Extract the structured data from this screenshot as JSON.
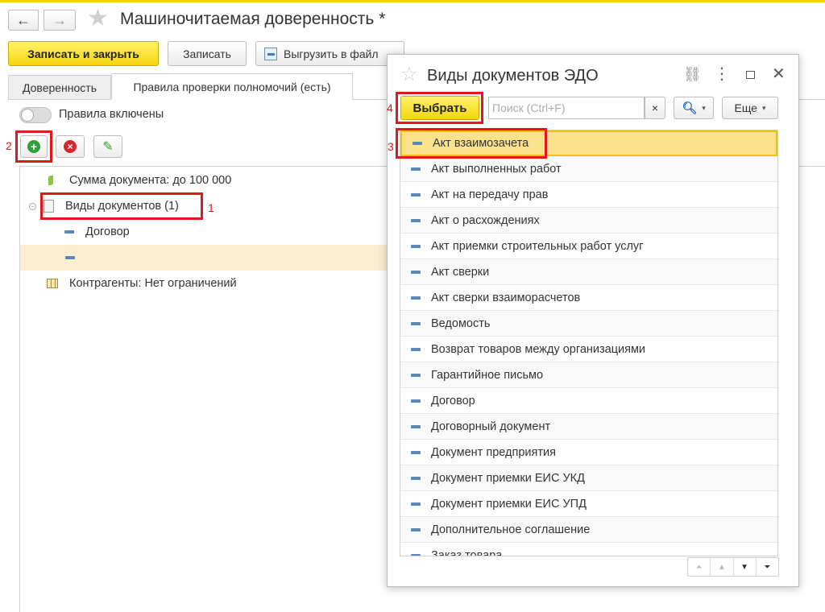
{
  "window": {
    "title": "Машиночитаемая доверенность *"
  },
  "toolbar": {
    "save_close": "Записать и закрыть",
    "save": "Записать",
    "export": "Выгрузить в файл"
  },
  "tabs": [
    {
      "label": "Доверенность"
    },
    {
      "label": "Правила проверки полномочий (есть)"
    }
  ],
  "toggle": {
    "label": "Правила включены"
  },
  "tree": {
    "items": [
      {
        "label": "Сумма документа: до 100 000"
      },
      {
        "label": "Виды документов (1)"
      },
      {
        "label": "Договор"
      },
      {
        "label": ""
      },
      {
        "label": "Контрагенты: Нет ограничений"
      }
    ]
  },
  "dialog": {
    "title": "Виды документов ЭДО",
    "select": "Выбрать",
    "search_placeholder": "Поиск (Ctrl+F)",
    "more": "Еще",
    "items": [
      "Акт взаимозачета",
      "Акт выполненных работ",
      "Акт на передачу прав",
      "Акт о расхождениях",
      "Акт приемки строительных работ услуг",
      "Акт сверки",
      "Акт сверки взаиморасчетов",
      "Ведомость",
      "Возврат товаров между организациями",
      "Гарантийное письмо",
      "Договор",
      "Договорный документ",
      "Документ предприятия",
      "Документ приемки ЕИС УКД",
      "Документ приемки ЕИС УПД",
      "Дополнительное соглашение",
      "Заказ товара"
    ]
  },
  "annotations": {
    "n1": "1",
    "n2": "2",
    "n3": "3",
    "n4": "4"
  },
  "colors": {
    "accent_yellow": "#f7dc2b",
    "highlight_red": "#e0181b",
    "selected_row": "#fbe38e"
  }
}
